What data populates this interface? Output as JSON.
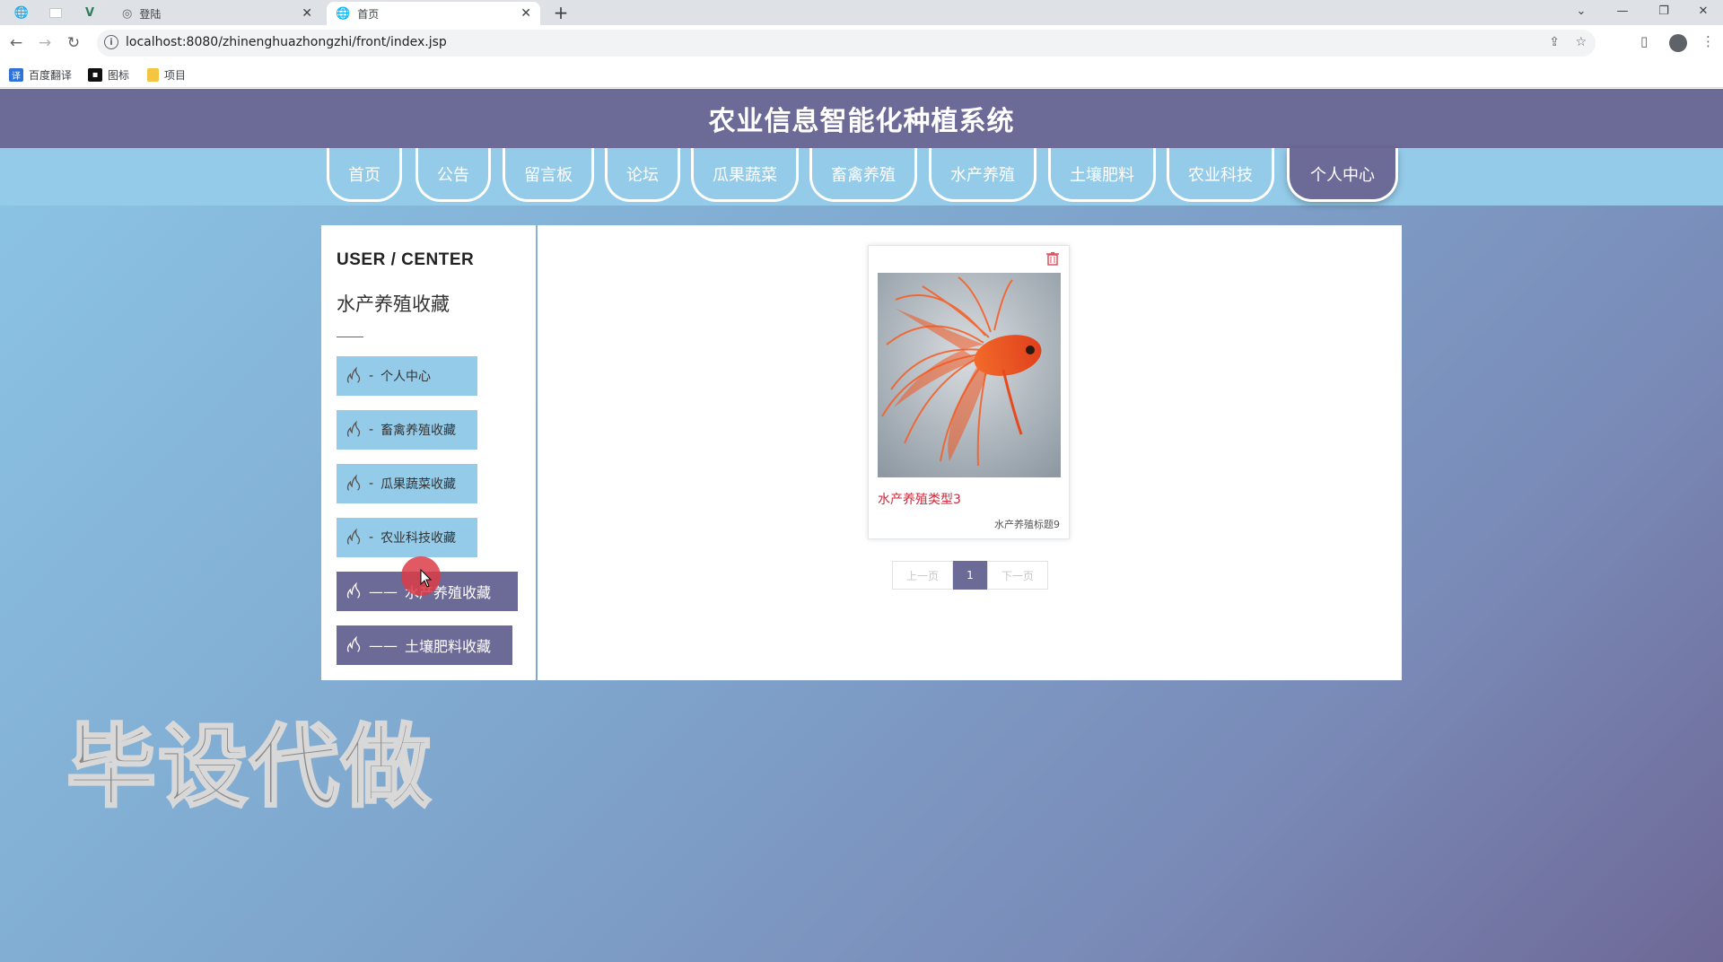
{
  "browser": {
    "tabs": [
      {
        "title": "登陆",
        "active": false
      },
      {
        "title": "首页",
        "active": true
      }
    ],
    "new_tab": "+",
    "url": "localhost:8080/zhinenghuazhongzhi/front/index.jsp",
    "bookmarks": [
      "百度翻译",
      "图标",
      "项目"
    ]
  },
  "site": {
    "title": "农业信息智能化种植系统",
    "nav": [
      "首页",
      "公告",
      "留言板",
      "论坛",
      "瓜果蔬菜",
      "畜禽养殖",
      "水产养殖",
      "土壤肥料",
      "农业科技",
      "个人中心"
    ],
    "nav_active": "个人中心"
  },
  "sidebar": {
    "title": "USER / CENTER",
    "subtitle": "水产养殖收藏",
    "items": [
      {
        "label": "个人中心",
        "dash": "-"
      },
      {
        "label": "畜禽养殖收藏",
        "dash": "-"
      },
      {
        "label": "瓜果蔬菜收藏",
        "dash": "-"
      },
      {
        "label": "农业科技收藏",
        "dash": "-"
      },
      {
        "label": "水产养殖收藏",
        "dash": "——"
      },
      {
        "label": "土壤肥料收藏",
        "dash": "——"
      }
    ]
  },
  "content": {
    "cards": [
      {
        "name": "水产养殖类型3",
        "subtitle": "水产养殖标题9",
        "image": "red-betta-fish"
      }
    ],
    "pager": {
      "prev": "上一页",
      "current": "1",
      "next": "下一页"
    }
  },
  "overlay": {
    "watermark": "毕设代做"
  },
  "colors": {
    "header": "#6c6a96",
    "nav": "#94cbe9",
    "accent_red": "#d0263a"
  }
}
